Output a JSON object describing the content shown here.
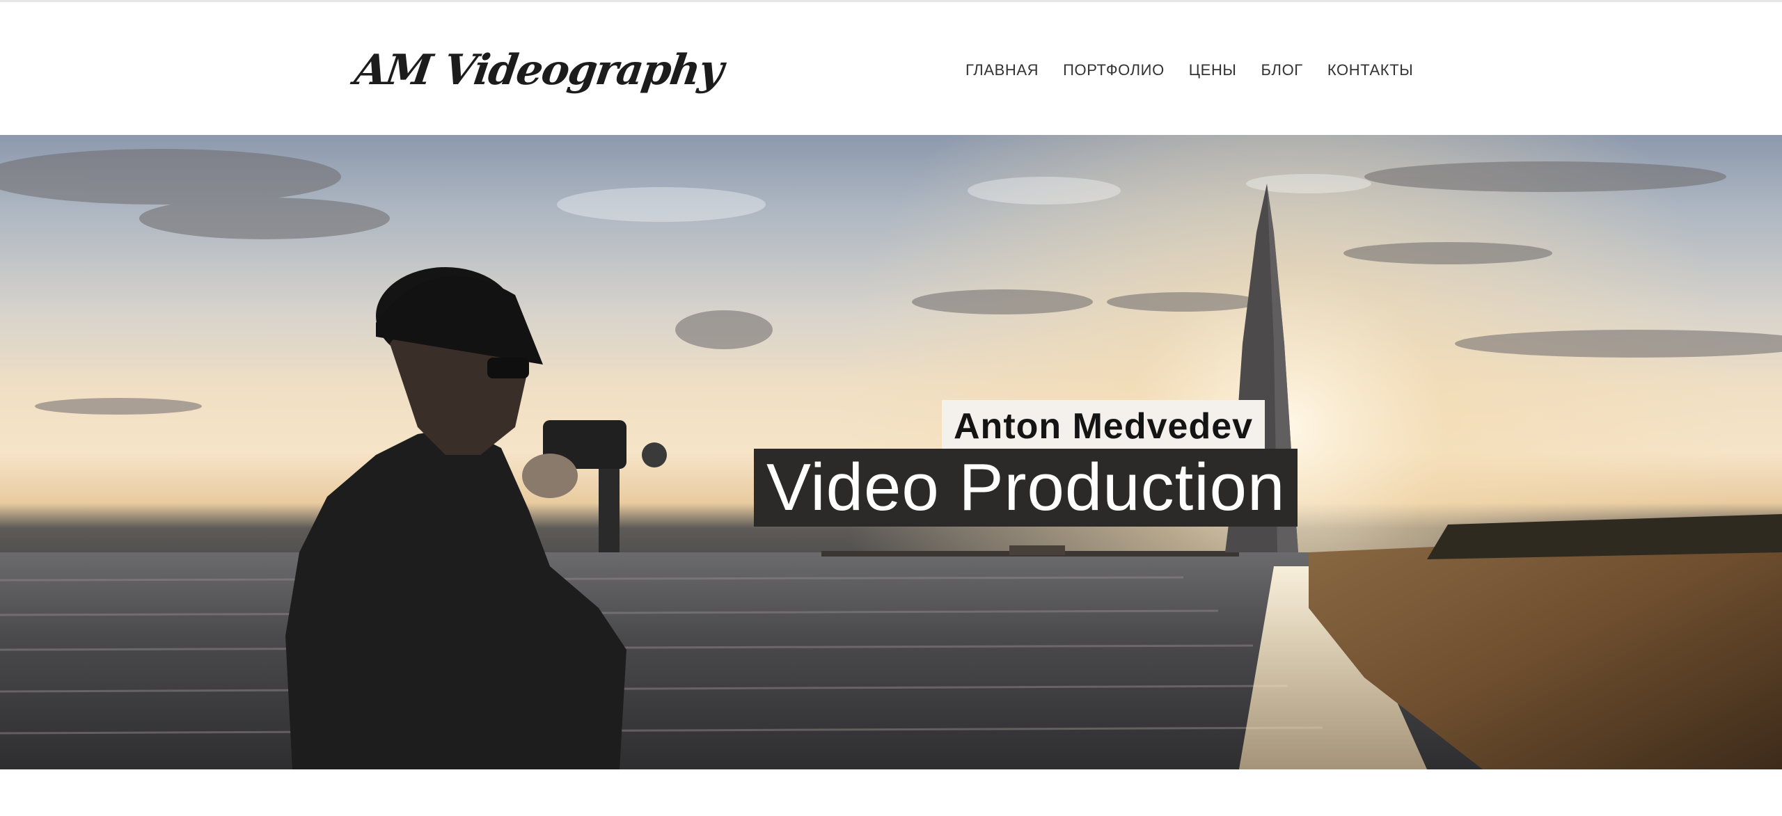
{
  "header": {
    "logo_text": "AM Videography",
    "nav": [
      {
        "label": "ГЛАВНАЯ"
      },
      {
        "label": "ПОРТФОЛИО"
      },
      {
        "label": "ЦЕНЫ"
      },
      {
        "label": "БЛОГ"
      },
      {
        "label": "КОНТАКТЫ"
      }
    ]
  },
  "hero": {
    "title": "Anton Medvedev",
    "subtitle": "Video Production"
  },
  "colors": {
    "text_dark": "#1c1c1c",
    "nav_text": "#333333",
    "title_box_bg": "#f4f1ec",
    "subtitle_box_bg": "#2b2a29"
  }
}
